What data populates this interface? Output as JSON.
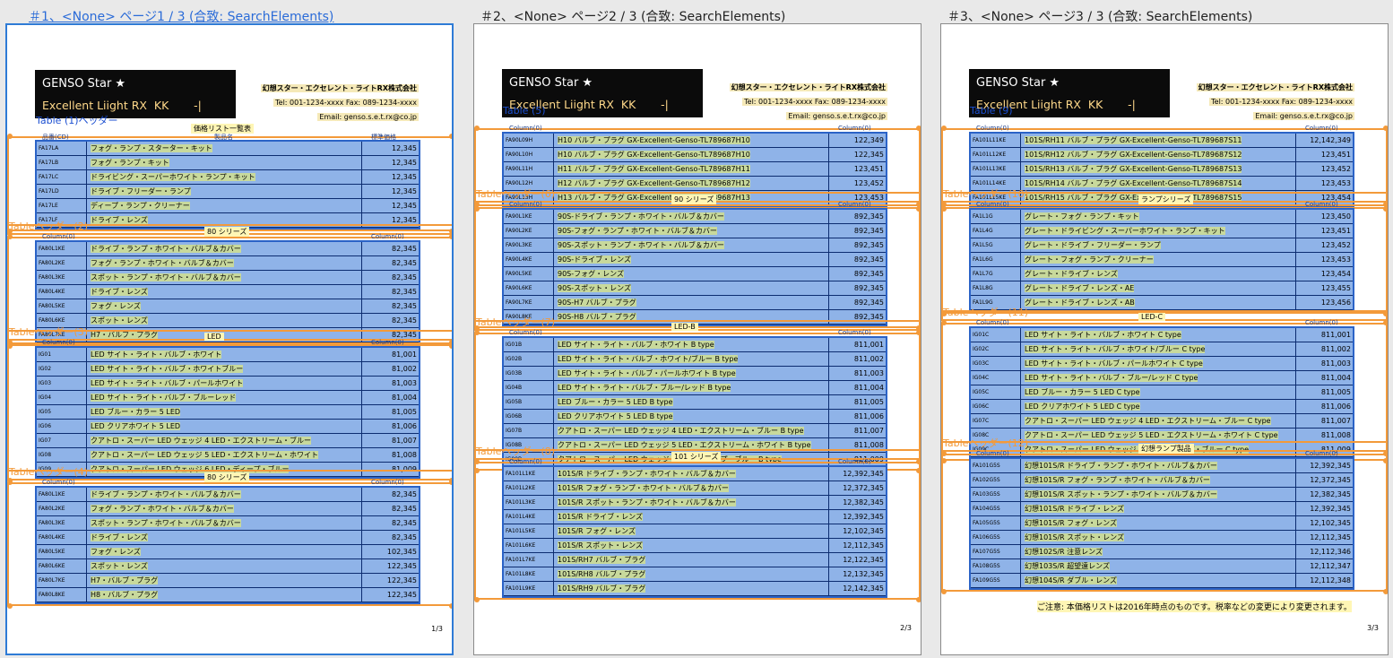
{
  "pages": [
    {
      "caption": "＃1、<None> ページ1 / 3 (合致: SearchElements)",
      "active": true,
      "logo": {
        "line1": "GENSO Star ★",
        "line2": "Excellent Liight RX  KK       -|"
      },
      "company": {
        "name": "幻想スター・エクセレント・ライトRX株式会社",
        "tel": "Tel: 001-1234-xxxx  Fax: 089-1234-xxxx",
        "email": "Email: genso.s.e.t.rx@co.jp"
      },
      "title": "価格リスト一覧表",
      "page_number": "1/3",
      "tables": [
        {
          "label": "Table (1)ヘッダー",
          "header_label": "",
          "columns": [
            "品番(CD)",
            "製品名",
            "標準価格"
          ],
          "rows": [
            [
              "FA17LA",
              "フォグ・ランプ・スターター・キット",
              "12,345"
            ],
            [
              "FA17LB",
              "フォグ・ランプ・キット",
              "12,345"
            ],
            [
              "FA17LC",
              "ドライビング・スーパーホワイト・ランプ・キット",
              "12,345"
            ],
            [
              "FA17LD",
              "ドライブ・フリーダー・ランプ",
              "12,345"
            ],
            [
              "FA17LE",
              "ディープ・ランプ・クリーナー",
              "12,345"
            ],
            [
              "FA17LF",
              "ドライブ・レンズ",
              "12,345"
            ]
          ]
        },
        {
          "label": "Tableヘッダー(2)",
          "header_label": "80 シリーズ",
          "columns": [
            "Column(0)",
            "",
            "Column(0)"
          ],
          "rows": [
            [
              "FA80L1KE",
              "ドライブ・ランプ・ホワイト・バルブ＆カバー",
              "82,345"
            ],
            [
              "FA80L2KE",
              "フォグ・ランプ・ホワイト・バルブ＆カバー",
              "82,345"
            ],
            [
              "FA80L3KE",
              "スポット・ランプ・ホワイト・バルブ＆カバー",
              "82,345"
            ],
            [
              "FA80L4KE",
              "ドライブ・レンズ",
              "82,345"
            ],
            [
              "FA80L5KE",
              "フォグ・レンズ",
              "82,345"
            ],
            [
              "FA80L6KE",
              "スポット・レンズ",
              "82,345"
            ],
            [
              "FA80L7KE",
              "H7・バルブ・プラグ",
              "82,345"
            ]
          ]
        },
        {
          "label": "Tableヘッダー(3)",
          "header_label": "LED",
          "columns": [
            "Column(0)",
            "",
            "Column(0)"
          ],
          "rows": [
            [
              "IG01",
              "LED サイト・ライト・バルブ・ホワイト",
              "81,001"
            ],
            [
              "IG02",
              "LED サイト・ライト・バルブ・ホワイトブルー",
              "81,002"
            ],
            [
              "IG03",
              "LED サイト・ライト・バルブ・パールホワイト",
              "81,003"
            ],
            [
              "IG04",
              "LED サイト・ライト・バルブ・ブルーレッド",
              "81,004"
            ],
            [
              "IG05",
              "LED ブルー・カラー 5 LED",
              "81,005"
            ],
            [
              "IG06",
              "LED クリアホワイト 5 LED",
              "81,006"
            ],
            [
              "IG07",
              "クアトロ・スーパー LED ウェッジ 4 LED・エクストリーム・ブルー",
              "81,007"
            ],
            [
              "IG08",
              "クアトロ・スーパー LED ウェッジ 5 LED・エクストリーム・ホワイト",
              "81,008"
            ],
            [
              "IG09",
              "クアトロ・スーパー LED ウェッジ 6 LED・ディープ・ブルー",
              "81,009"
            ]
          ]
        },
        {
          "label": "Tableヘッダー(4)",
          "header_label": "80 シリーズ",
          "columns": [
            "Column(0)",
            "",
            "Column(0)"
          ],
          "rows": [
            [
              "FA80L1KE",
              "ドライブ・ランプ・ホワイト・バルブ＆カバー",
              "82,345"
            ],
            [
              "FA80L2KE",
              "フォグ・ランプ・ホワイト・バルブ＆カバー",
              "82,345"
            ],
            [
              "FA80L3KE",
              "スポット・ランプ・ホワイト・バルブ＆カバー",
              "82,345"
            ],
            [
              "FA80L4KE",
              "ドライブ・レンズ",
              "82,345"
            ],
            [
              "FA80L5KE",
              "フォグ・レンズ",
              "102,345"
            ],
            [
              "FA80L6KE",
              "スポット・レンズ",
              "122,345"
            ],
            [
              "FA80L7KE",
              "H7・バルブ・プラグ",
              "122,345"
            ],
            [
              "FA80L8KE",
              "H8・バルブ・プラグ",
              "122,345"
            ]
          ]
        }
      ]
    },
    {
      "caption": "＃2、<None> ページ2 / 3 (合致: SearchElements)",
      "active": false,
      "logo": {
        "line1": "GENSO Star ★",
        "line2": "Excellent Liight RX  KK       -|"
      },
      "company": {
        "name": "幻想スター・エクセレント・ライトRX株式会社",
        "tel": "Tel: 001-1234-xxxx  Fax: 089-1234-xxxx",
        "email": "Email: genso.s.e.t.rx@co.jp"
      },
      "title": "",
      "page_number": "2/3",
      "tables": [
        {
          "label": "Table (5)",
          "header_label": "",
          "columns": [
            "Column(0)",
            "",
            "Column(0)"
          ],
          "rows": [
            [
              "FA90L09H",
              "H10 バルブ・プラグ GX-Excellent-Genso-TL789687H10",
              "122,349"
            ],
            [
              "FA90L10H",
              "H10 バルブ・プラグ GX-Excellent-Genso-TL789687H10",
              "122,345"
            ],
            [
              "FA90L11H",
              "H11 バルブ・プラグ GX-Excellent-Genso-TL789687H11",
              "123,451"
            ],
            [
              "FA90L12H",
              "H12 バルブ・プラグ GX-Excellent-Genso-TL789687H12",
              "123,452"
            ],
            [
              "FA90L13H",
              "H13 バルブ・プラグ GX-Excellent-Genso-TL789687H13",
              "123,453"
            ]
          ]
        },
        {
          "label": "Tableヘッダー(6)",
          "header_label": "90 シリーズ",
          "columns": [
            "Column(0)",
            "",
            "Column(0)"
          ],
          "rows": [
            [
              "FA90L1KE",
              "90S-ドライブ・ランプ・ホワイト・バルブ＆カバー",
              "892,345"
            ],
            [
              "FA90L2KE",
              "90S-フォグ・ランプ・ホワイト・バルブ＆カバー",
              "892,345"
            ],
            [
              "FA90L3KE",
              "90S-スポット・ランプ・ホワイト・バルブ＆カバー",
              "892,345"
            ],
            [
              "FA90L4KE",
              "90S-ドライブ・レンズ",
              "892,345"
            ],
            [
              "FA90L5KE",
              "90S-フォグ・レンズ",
              "892,345"
            ],
            [
              "FA90L6KE",
              "90S-スポット・レンズ",
              "892,345"
            ],
            [
              "FA90L7KE",
              "90S-H7 バルブ・プラグ",
              "892,345"
            ],
            [
              "FA90L8KE",
              "90S-H8 バルブ・プラグ",
              "892,345"
            ]
          ]
        },
        {
          "label": "Tableヘッダー(7)",
          "header_label": "LED-B",
          "columns": [
            "Column(0)",
            "",
            "Column(0)"
          ],
          "rows": [
            [
              "IG01B",
              "LED サイト・ライト・バルブ・ホワイト B type",
              "811,001"
            ],
            [
              "IG02B",
              "LED サイト・ライト・バルブ・ホワイト/ブルー B type",
              "811,002"
            ],
            [
              "IG03B",
              "LED サイト・ライト・バルブ・パールホワイト B type",
              "811,003"
            ],
            [
              "IG04B",
              "LED サイト・ライト・バルブ・ブルー/レッド B type",
              "811,004"
            ],
            [
              "IG05B",
              "LED ブルー・カラー 5 LED B type",
              "811,005"
            ],
            [
              "IG06B",
              "LED クリアホワイト 5 LED B type",
              "811,006"
            ],
            [
              "IG07B",
              "クアトロ・スーパー LED ウェッジ 4 LED・エクストリーム・ブルー B type",
              "811,007"
            ],
            [
              "IG08B",
              "クアトロ・スーパー LED ウェッジ 5 LED・エクストリーム・ホワイト B type",
              "811,008"
            ],
            [
              "IG09B",
              "クアトロ・スーパー LED ウェッジ 6 LED・ディープ・ブルー B type",
              "811,009"
            ]
          ]
        },
        {
          "label": "Tableヘッダー(8)",
          "header_label": "101 シリーズ",
          "columns": [
            "Column(0)",
            "",
            "Column(0)"
          ],
          "rows": [
            [
              "FA101L1KE",
              "101S/R ドライブ・ランプ・ホワイト・バルブ＆カバー",
              "12,392,345"
            ],
            [
              "FA101L2KE",
              "101S/R フォグ・ランプ・ホワイト・バルブ＆カバー",
              "12,372,345"
            ],
            [
              "FA101L3KE",
              "101S/R スポット・ランプ・ホワイト・バルブ＆カバー",
              "12,382,345"
            ],
            [
              "FA101L4KE",
              "101S/R ドライブ・レンズ",
              "12,392,345"
            ],
            [
              "FA101L5KE",
              "101S/R フォグ・レンズ",
              "12,102,345"
            ],
            [
              "FA101L6KE",
              "101S/R スポット・レンズ",
              "12,112,345"
            ],
            [
              "FA101L7KE",
              "101S/RH7 バルブ・プラグ",
              "12,122,345"
            ],
            [
              "FA101L8KE",
              "101S/RH8 バルブ・プラグ",
              "12,132,345"
            ],
            [
              "FA101L9KE",
              "101S/RH9 バルブ・プラグ",
              "12,142,345"
            ]
          ]
        }
      ]
    },
    {
      "caption": "＃3、<None> ページ3 / 3 (合致: SearchElements)",
      "active": false,
      "logo": {
        "line1": "GENSO Star ★",
        "line2": "Excellent Liight RX  KK       -|"
      },
      "company": {
        "name": "幻想スター・エクセレント・ライトRX株式会社",
        "tel": "Tel: 001-1234-xxxx  Fax: 089-1234-xxxx",
        "email": "Email: genso.s.e.t.rx@co.jp"
      },
      "title": "",
      "page_number": "3/3",
      "footer_note": "ご注意: 本価格リストは2016年時点のものです。税率などの変更により変更されます。",
      "tables": [
        {
          "label": "Table (9)",
          "header_label": "",
          "columns": [
            "Column(0)",
            "",
            "Column(0)"
          ],
          "rows": [
            [
              "FA101L11KE",
              "101S/RH11 バルブ・プラグ GX-Excellent-Genso-TL789687S11",
              "12,142,349"
            ],
            [
              "FA101L12KE",
              "101S/RH12 バルブ・プラグ GX-Excellent-Genso-TL789687S12",
              "123,451"
            ],
            [
              "FA101L13KE",
              "101S/RH13 バルブ・プラグ GX-Excellent-Genso-TL789687S13",
              "123,452"
            ],
            [
              "FA101L14KE",
              "101S/RH14 バルブ・プラグ GX-Excellent-Genso-TL789687S14",
              "123,453"
            ],
            [
              "FA101L15KE",
              "101S/RH15 バルブ・プラグ GX-Excellent-Genso-TL789687S15",
              "123,454"
            ]
          ]
        },
        {
          "label": "Tableヘッダー(10)",
          "header_label": "ランプシリーズ",
          "columns": [
            "Column(0)",
            "",
            "Column(0)"
          ],
          "rows": [
            [
              "FA1L1G",
              "グレート・フォグ・ランプ・キット",
              "123,450"
            ],
            [
              "FA1L4G",
              "グレート・ドライビング・スーパーホワイト・ランプ・キット",
              "123,451"
            ],
            [
              "FA1L5G",
              "グレート・ドライブ・フリーダー・ランプ",
              "123,452"
            ],
            [
              "FA1L6G",
              "グレート・フォグ・ランプ・クリーナー",
              "123,453"
            ],
            [
              "FA1L7G",
              "グレート・ドライブ・レンズ",
              "123,454"
            ],
            [
              "FA1L8G",
              "グレート・ドライブ・レンズ・AE",
              "123,455"
            ],
            [
              "FA1L9G",
              "グレート・ドライブ・レンズ・AB",
              "123,456"
            ]
          ]
        },
        {
          "label": "Tableヘッダー(11)",
          "header_label": "LED-C",
          "columns": [
            "Column(0)",
            "",
            "Column(0)"
          ],
          "rows": [
            [
              "IG01C",
              "LED サイト・ライト・バルブ・ホワイト C type",
              "811,001"
            ],
            [
              "IG02C",
              "LED サイト・ライト・バルブ・ホワイト/ブルー C type",
              "811,002"
            ],
            [
              "IG03C",
              "LED サイト・ライト・バルブ・パールホワイト C type",
              "811,003"
            ],
            [
              "IG04C",
              "LED サイト・ライト・バルブ・ブルー/レッド C type",
              "811,004"
            ],
            [
              "IG05C",
              "LED ブルー・カラー 5 LED C type",
              "811,005"
            ],
            [
              "IG06C",
              "LED クリアホワイト 5 LED C type",
              "811,006"
            ],
            [
              "IG07C",
              "クアトロ・スーパー LED ウェッジ 4 LED・エクストリーム・ブルー C type",
              "811,007"
            ],
            [
              "IG08C",
              "クアトロ・スーパー LED ウェッジ 5 LED・エクストリーム・ホワイト C type",
              "811,008"
            ],
            [
              "IG09C",
              "クアトロ・スーパー LED ウェッジ 6 LED・ディープ・ブルー C type",
              "811,009"
            ]
          ]
        },
        {
          "label": "Tableヘッダー(12)",
          "header_label": "幻想ランプ製品",
          "columns": [
            "Column(0)",
            "",
            "Column(0)"
          ],
          "rows": [
            [
              "FA101G5S",
              "幻想101S/R ドライブ・ランプ・ホワイト・バルブ＆カバー",
              "12,392,345"
            ],
            [
              "FA102G5S",
              "幻想101S/R フォグ・ランプ・ホワイト・バルブ＆カバー",
              "12,372,345"
            ],
            [
              "FA103G5S",
              "幻想101S/R スポット・ランプ・ホワイト・バルブ＆カバー",
              "12,382,345"
            ],
            [
              "FA104G5S",
              "幻想101S/R ドライブ・レンズ",
              "12,392,345"
            ],
            [
              "FA105G5S",
              "幻想101S/R フォグ・レンズ",
              "12,102,345"
            ],
            [
              "FA106G5S",
              "幻想101S/R スポット・レンズ",
              "12,112,345"
            ],
            [
              "FA107G5S",
              "幻想102S/R 注意レンズ",
              "12,112,346"
            ],
            [
              "FA108G5S",
              "幻想103S/R 超望遠レンズ",
              "12,112,347"
            ],
            [
              "FA109G5S",
              "幻想104S/R ダブル・レンズ",
              "12,112,348"
            ]
          ]
        }
      ]
    }
  ]
}
